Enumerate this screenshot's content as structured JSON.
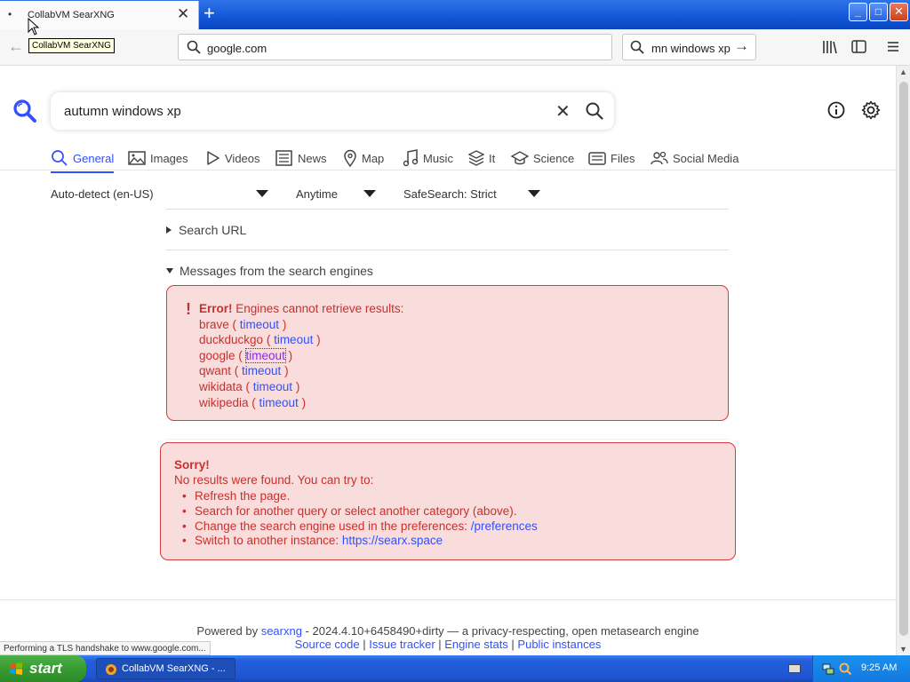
{
  "browser": {
    "tab_title": "CollabVM SearXNG",
    "tooltip": "CollabVM SearXNG",
    "url": "google.com",
    "search_box": "mn windows xp",
    "new_tab_label": "+",
    "tab_close": "✕",
    "window_min": "_",
    "window_max": "□",
    "window_close": "✕",
    "status": "Performing a TLS handshake to www.google.com..."
  },
  "search": {
    "query": "autumn windows xp",
    "clear_label": "✕"
  },
  "categories": [
    {
      "label": "General",
      "icon": "search-icon"
    },
    {
      "label": "Images",
      "icon": "image-icon"
    },
    {
      "label": "Videos",
      "icon": "play-icon"
    },
    {
      "label": "News",
      "icon": "newspaper-icon"
    },
    {
      "label": "Map",
      "icon": "map-pin-icon"
    },
    {
      "label": "Music",
      "icon": "music-note-icon"
    },
    {
      "label": "It",
      "icon": "layers-icon"
    },
    {
      "label": "Science",
      "icon": "graduation-cap-icon"
    },
    {
      "label": "Files",
      "icon": "file-tray-icon"
    },
    {
      "label": "Social Media",
      "icon": "people-icon"
    }
  ],
  "filters": {
    "language": "Auto-detect (en-US)",
    "time": "Anytime",
    "safesearch": "SafeSearch: Strict"
  },
  "search_url_label": "Search URL",
  "messages": {
    "heading": "Messages from the search engines",
    "error_bold": "Error!",
    "error_text": "Engines cannot retrieve results:",
    "engines": [
      {
        "name": "brave",
        "reason": "timeout"
      },
      {
        "name": "duckduckgo",
        "reason": "timeout"
      },
      {
        "name": "google",
        "reason": "timeout"
      },
      {
        "name": "qwant",
        "reason": "timeout"
      },
      {
        "name": "wikidata",
        "reason": "timeout"
      },
      {
        "name": "wikipedia",
        "reason": "timeout"
      }
    ]
  },
  "sorry": {
    "title": "Sorry!",
    "subtitle": "No results were found. You can try to:",
    "item1": "Refresh the page.",
    "item2": "Search for another query or select another category (above).",
    "item3_text": "Change the search engine used in the preferences: ",
    "item3_link": "/preferences",
    "item4_text": "Switch to another instance: ",
    "item4_link": "https://searx.space"
  },
  "footer": {
    "powered_by": "Powered by ",
    "searxng": "searxng",
    "version_text": " - 2024.4.10+6458490+dirty — a privacy-respecting, open metasearch engine",
    "source_code": "Source code",
    "issue_tracker": "Issue tracker",
    "engine_stats": "Engine stats",
    "public_instances": "Public instances",
    "sep": " | "
  },
  "taskbar": {
    "start_label": "start",
    "task_label": "CollabVM SearXNG - ...",
    "clock": "9:25 AM"
  },
  "colors": {
    "accent": "#3050ff",
    "error_text": "#c9302c",
    "error_bg": "#f9dcdc"
  }
}
